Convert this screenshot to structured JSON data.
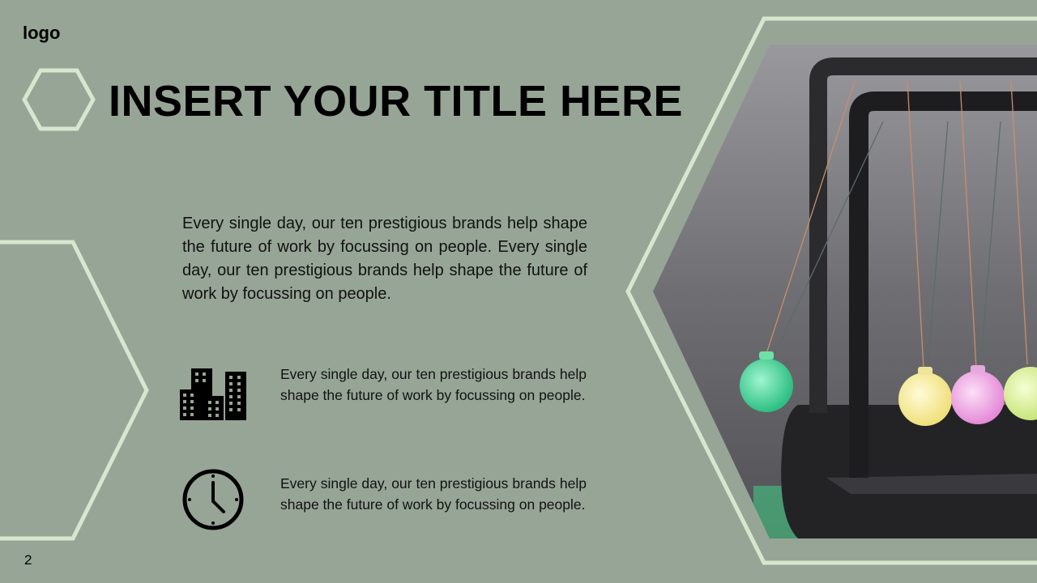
{
  "header": {
    "logo_text": "logo",
    "title": "INSERT YOUR TITLE HERE"
  },
  "main": {
    "intro_text": "Every single day, our ten prestigious brands help shape the future of work by focussing on people. Every single day, our ten prestigious brands help shape the future of work by focussing on people.",
    "items": [
      {
        "icon": "buildings-icon",
        "text": "Every single day, our ten prestigious brands help shape the future of work by focussing on people."
      },
      {
        "icon": "clock-icon",
        "text": "Every single day, our ten prestigious brands help shape the future of work by focussing on people."
      }
    ]
  },
  "footer": {
    "page_number": "2"
  },
  "colors": {
    "background": "#97a597",
    "hex_outline": "#d6e7cf",
    "text": "#000000"
  }
}
